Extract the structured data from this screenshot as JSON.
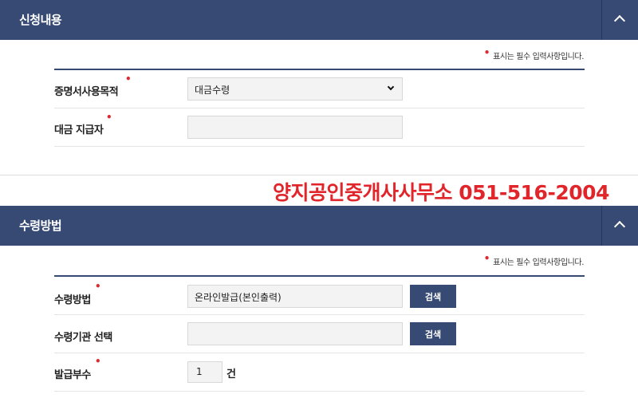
{
  "section1": {
    "title": "신청내용",
    "required_note": "표시는 필수 입력사항입니다.",
    "fields": {
      "purpose_label": "증명서사용목적",
      "purpose_value": "대금수령",
      "payer_label": "대금 지급자",
      "payer_value": ""
    }
  },
  "promo": {
    "text": "양지공인중개사사무소 051-516-2004",
    "color": "#e0252b"
  },
  "section2": {
    "title": "수령방법",
    "required_note": "표시는 필수 입력사항입니다.",
    "fields": {
      "method_label": "수령방법",
      "method_value": "온라인발급(본인출력)",
      "method_button": "검색",
      "agency_label": "수령기관 선택",
      "agency_value": "",
      "agency_button": "검색",
      "copies_label": "발급부수",
      "copies_value": "1",
      "copies_unit": "건"
    }
  },
  "colors": {
    "header_bg": "#364a73",
    "required_mark": "#e0282e"
  }
}
